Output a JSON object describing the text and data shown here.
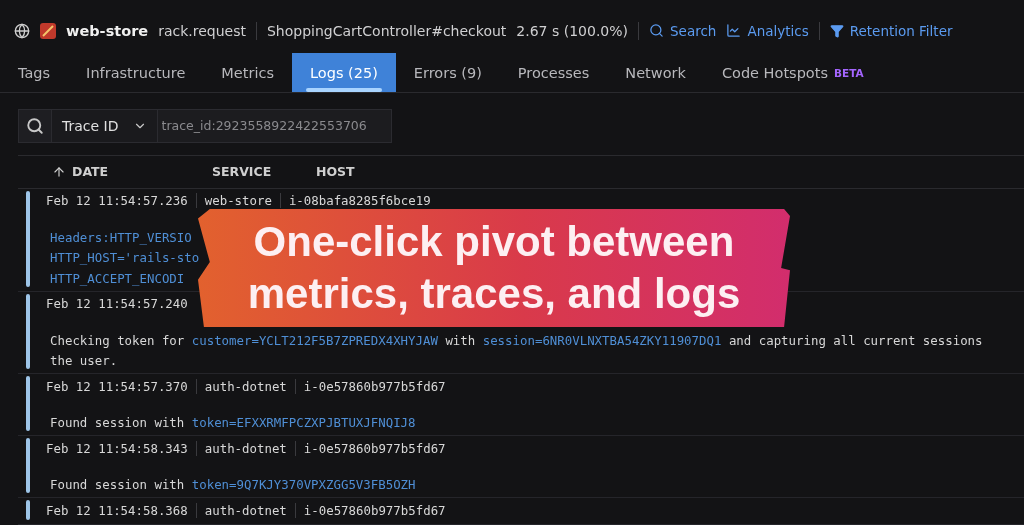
{
  "header": {
    "service": "web-store",
    "operation": "rack.request",
    "resource": "ShoppingCartController#checkout",
    "duration": "2.67 s (100.0%)",
    "actions": [
      {
        "kind": "search",
        "label": "Search"
      },
      {
        "kind": "analytics",
        "label": "Analytics"
      },
      {
        "kind": "filter",
        "label": "Retention Filter"
      }
    ]
  },
  "tabs": [
    {
      "label": "Tags",
      "selected": false
    },
    {
      "label": "Infrastructure",
      "selected": false
    },
    {
      "label": "Metrics",
      "selected": false
    },
    {
      "label": "Logs (25)",
      "selected": true
    },
    {
      "label": "Errors (9)",
      "selected": false
    },
    {
      "label": "Processes",
      "selected": false
    },
    {
      "label": "Network",
      "selected": false
    },
    {
      "label": "Code Hotspots",
      "badge": "BETA",
      "selected": false
    }
  ],
  "search": {
    "facet": "Trace ID",
    "value": "trace_id:2923558922422553706"
  },
  "table": {
    "columns": [
      "DATE",
      "SERVICE",
      "HOST"
    ],
    "rows": [
      {
        "date": "Feb 12 11:54:57.236",
        "service": "web-store",
        "host": "i-08bafa8285f6bce19",
        "lines": [
          [
            {
              "kind": "link",
              "text": "Headers:HTTP_VERSIO"
            }
          ],
          [
            {
              "kind": "link",
              "text": "HTTP_HOST='rails-sto"
            }
          ],
          [
            {
              "kind": "link",
              "text": "HTTP_ACCEPT_ENCODI"
            }
          ]
        ]
      },
      {
        "date": "Feb 12 11:54:57.240",
        "lines": [
          [
            {
              "kind": "plain",
              "text": "Checking token for "
            },
            {
              "kind": "link",
              "text": "customer=YCLT212F5B7ZPREDX4XHYJAW"
            },
            {
              "kind": "plain",
              "text": " with "
            },
            {
              "kind": "link",
              "text": "session=6NR0VLNXTBA54ZKY11907DQ1"
            },
            {
              "kind": "plain",
              "text": " and capturing all current sessions"
            }
          ],
          [
            {
              "kind": "plain",
              "text": "the user."
            }
          ]
        ]
      },
      {
        "date": "Feb 12 11:54:57.370",
        "service": "auth-dotnet",
        "host": "i-0e57860b977b5fd67",
        "lines": [
          [
            {
              "kind": "plain",
              "text": "Found session with "
            },
            {
              "kind": "link",
              "text": "token=EFXXRMFPCZXPJBTUXJFNQIJ8"
            }
          ]
        ]
      },
      {
        "date": "Feb 12 11:54:58.343",
        "service": "auth-dotnet",
        "host": "i-0e57860b977b5fd67",
        "lines": [
          [
            {
              "kind": "plain",
              "text": "Found session with "
            },
            {
              "kind": "link",
              "text": "token=9Q7KJY370VPXZGG5V3FB5OZH"
            }
          ]
        ]
      },
      {
        "date": "Feb 12 11:54:58.368",
        "service": "auth-dotnet",
        "host": "i-0e57860b977b5fd67",
        "lines": []
      }
    ]
  },
  "banner": {
    "text": "One-click pivot between metrics, traces, and logs"
  }
}
